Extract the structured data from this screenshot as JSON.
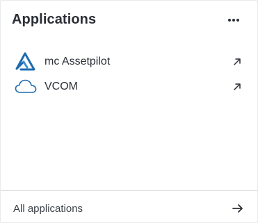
{
  "header": {
    "title": "Applications",
    "menu_icon": "more-horizontal-icon"
  },
  "apps": [
    {
      "label": "mc Assetpilot",
      "icon": "assetpilot-logo-icon",
      "action_icon": "external-link-icon"
    },
    {
      "label": "VCOM",
      "icon": "cloud-icon",
      "action_icon": "external-link-icon"
    }
  ],
  "footer": {
    "label": "All applications",
    "icon": "arrow-right-icon"
  },
  "colors": {
    "brand_blue": "#1f6bb0",
    "brand_light": "#3d8fd3",
    "text": "#2b2f36",
    "divider": "#d7dade"
  }
}
